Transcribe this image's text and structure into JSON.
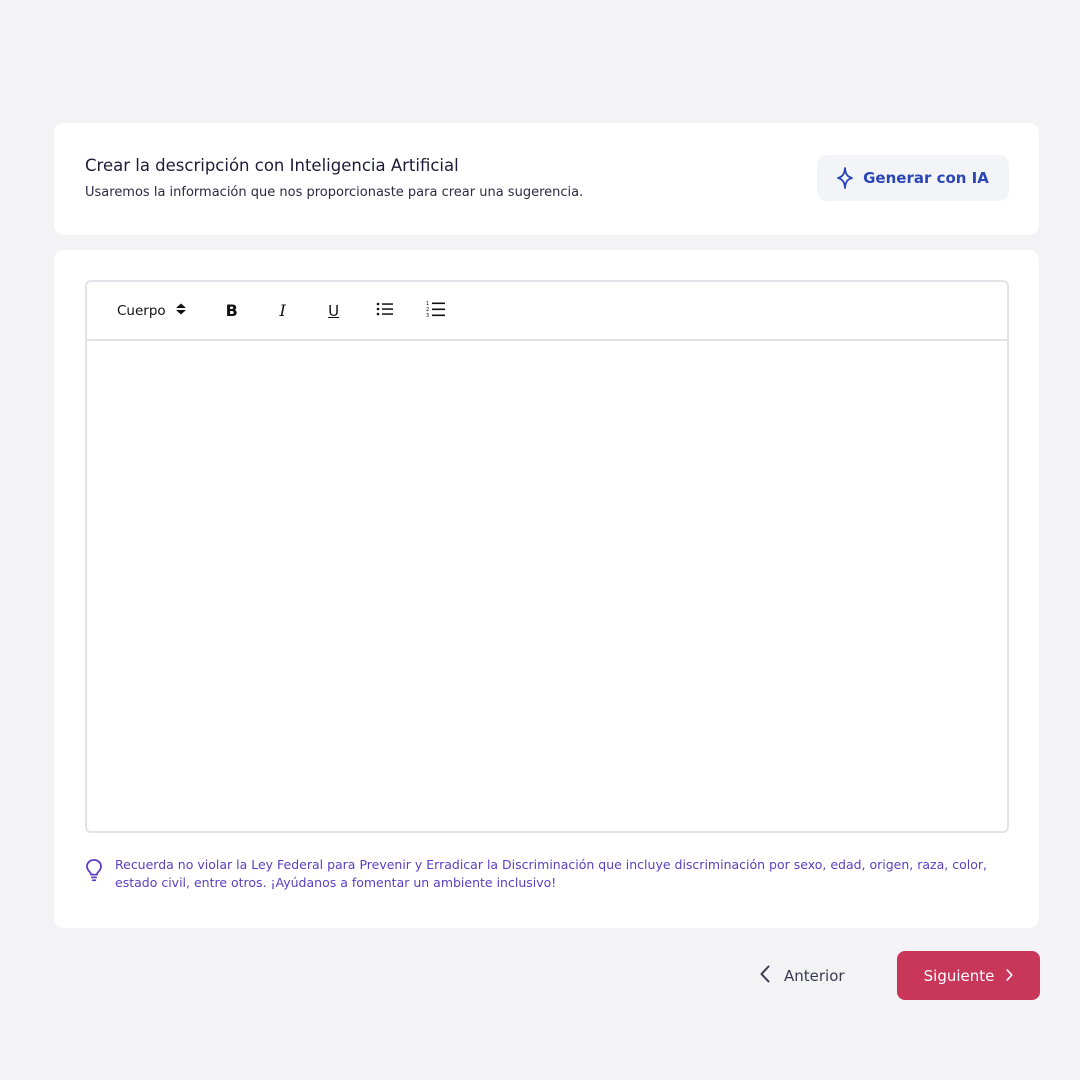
{
  "ai_card": {
    "title": "Crear la descripción con Inteligencia Artificial",
    "subtitle": "Usaremos la información que nos proporcionaste para crear una sugerencia.",
    "generate_label": "Generar con IA",
    "generate_icon": "sparkle-icon"
  },
  "editor": {
    "format_label": "Cuerpo",
    "toolbar": {
      "bold": "B",
      "italic": "I",
      "underline": "U",
      "bullet_list_icon": "bullet-list-icon",
      "numbered_list_icon": "numbered-list-icon"
    },
    "content": ""
  },
  "hint": {
    "icon": "lightbulb-icon",
    "text": "Recuerda no violar la Ley Federal para Prevenir y Erradicar la Discriminación que incluye discriminación por sexo, edad, origen, raza, color, estado civil, entre otros. ¡Ayúdanos a fomentar un ambiente inclusivo!"
  },
  "navigation": {
    "previous_label": "Anterior",
    "next_label": "Siguiente"
  },
  "colors": {
    "accent_blue": "#2b46b5",
    "primary_button": "#c8365a",
    "hint_purple": "#5b3fc0"
  }
}
